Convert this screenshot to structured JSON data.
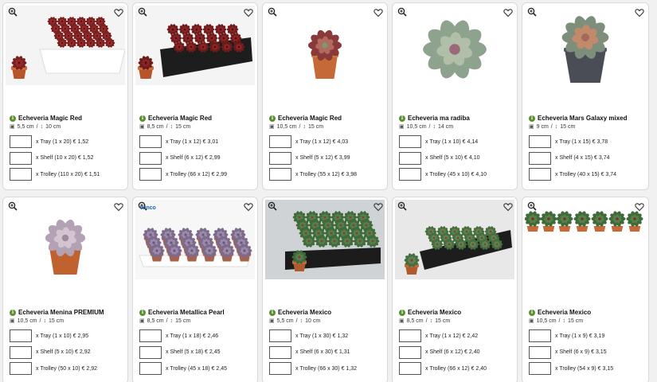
{
  "products": [
    {
      "name": "Echeveria Magic Red",
      "pot_size": "5,5 cm",
      "height": "10 cm",
      "image": "echeveria-magic-red-tray-pack",
      "brand": "",
      "orders": [
        {
          "label": "x Tray (1 x 20) € 1,52"
        },
        {
          "label": "x Shelf (10 x 20) € 1,52"
        },
        {
          "label": "x Trolley (110 x 20) € 1,51"
        }
      ]
    },
    {
      "name": "Echeveria Magic Red",
      "pot_size": "8,5 cm",
      "height": "15 cm",
      "image": "echeveria-magic-red-black-tray",
      "brand": "",
      "orders": [
        {
          "label": "x Tray (1 x 12) € 3,01"
        },
        {
          "label": "x Shelf (6 x 12) € 2,99"
        },
        {
          "label": "x Trolley (66 x 12) € 2,99"
        }
      ]
    },
    {
      "name": "Echeveria Magic Red",
      "pot_size": "10,5 cm",
      "height": "15 cm",
      "image": "echeveria-magic-red-single-pot",
      "brand": "",
      "orders": [
        {
          "label": "x Tray (1 x 12) € 4,03"
        },
        {
          "label": "x Shelf (5 x 12) € 3,99"
        },
        {
          "label": "x Trolley (55 x 12) € 3,98"
        }
      ]
    },
    {
      "name": "Echeveria ma radiba",
      "pot_size": "10,5 cm",
      "height": "14 cm",
      "image": "echeveria-maradiba-rosette",
      "brand": "",
      "orders": [
        {
          "label": "x Tray (1 x 10) € 4,14"
        },
        {
          "label": "x Shelf (5 x 10) € 4,10"
        },
        {
          "label": "x Trolley (45 x 10) € 4,10"
        }
      ]
    },
    {
      "name": "Echeveria Mars Galaxy mixed",
      "pot_size": "9 cm",
      "height": "15 cm",
      "image": "echeveria-mars-galaxy-grey-pot",
      "brand": "",
      "orders": [
        {
          "label": "x Tray (1 x 15) € 3,78"
        },
        {
          "label": "x Shelf (4 x 15) € 3,74"
        },
        {
          "label": "x Trolley (40 x 15) € 3,74"
        }
      ]
    },
    {
      "name": "Echeveria Menina PREMIUM",
      "pot_size": "10,5 cm",
      "height": "15 cm",
      "image": "echeveria-menina-terracotta-pot",
      "brand": "",
      "orders": [
        {
          "label": "x Tray (1 x 10) € 2,95"
        },
        {
          "label": "x Shelf (5 x 10) € 2,92"
        },
        {
          "label": "x Trolley (50 x 10) € 2,92"
        }
      ]
    },
    {
      "name": "Echeveria Metallica Pearl",
      "pot_size": "8,5 cm",
      "height": "15 cm",
      "image": "echeveria-metallica-pearl-white-tray",
      "brand": "winco",
      "orders": [
        {
          "label": "x Tray (1 x 18) € 2,46"
        },
        {
          "label": "x Shelf (5 x 18) € 2,45"
        },
        {
          "label": "x Trolley (45 x 18) € 2,45"
        }
      ]
    },
    {
      "name": "Echeveria Mexico",
      "pot_size": "5,5 cm",
      "height": "10 cm",
      "image": "echeveria-mexico-green-tray",
      "brand": "",
      "orders": [
        {
          "label": "x Tray (1 x 30) € 1,32"
        },
        {
          "label": "x Shelf (6 x 30) € 1,31"
        },
        {
          "label": "x Trolley (66 x 30) € 1,32"
        }
      ]
    },
    {
      "name": "Echeveria Mexico",
      "pot_size": "8,5 cm",
      "height": "15 cm",
      "image": "echeveria-mexico-black-tray",
      "brand": "",
      "orders": [
        {
          "label": "x Tray (1 x 12) € 2,42"
        },
        {
          "label": "x Shelf (6 x 12) € 2,40"
        },
        {
          "label": "x Trolley (66 x 12) € 2,40"
        }
      ]
    },
    {
      "name": "Echeveria Mexico",
      "pot_size": "10,5 cm",
      "height": "15 cm",
      "image": "echeveria-mexico-row-pots",
      "brand": "",
      "orders": [
        {
          "label": "x Tray (1 x 9) € 3,19"
        },
        {
          "label": "x Shelf (6 x 9) € 3,15"
        },
        {
          "label": "x Trolley (54 x 9) € 3,15"
        }
      ]
    }
  ],
  "labels": {
    "size_separator": "/"
  },
  "colors": {
    "info_icon": "#5b8f2f",
    "card_border": "#d9d9d9",
    "background": "#f1f1f1",
    "brand_blue": "#1a63b8"
  },
  "icons": {
    "zoom": "magnifier-plus-icon",
    "favorite": "heart-outline-icon",
    "info": "info-circle-icon",
    "pot": "pot-icon",
    "height": "height-arrow-icon"
  }
}
